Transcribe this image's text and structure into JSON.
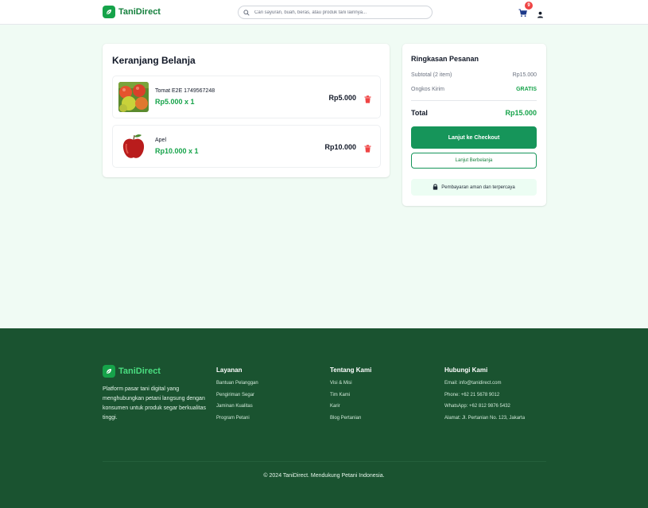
{
  "header": {
    "brand": "TaniDirect",
    "search_placeholder": "Cari sayuran, buah, beras, atau produk tani lainnya...",
    "cart_count": "9"
  },
  "cart": {
    "title": "Keranjang Belanja",
    "items": [
      {
        "name": "Tomat E2E 1749567248",
        "price_qty": "Rp5.000 x 1",
        "total": "Rp5.000"
      },
      {
        "name": "Apel",
        "price_qty": "Rp10.000 x 1",
        "total": "Rp10.000"
      }
    ]
  },
  "summary": {
    "title": "Ringkasan Pesanan",
    "subtotal_label": "Subtotal (2 item)",
    "subtotal_value": "Rp15.000",
    "shipping_label": "Ongkos Kirim",
    "shipping_value": "GRATIS",
    "total_label": "Total",
    "total_value": "Rp15.000",
    "checkout_label": "Lanjut ke Checkout",
    "continue_label": "Lanjut Berbelanja",
    "secure_text": "Pembayaran aman dan terpercaya"
  },
  "footer": {
    "brand": "TaniDirect",
    "about": "Platform pasar tani digital yang menghubungkan petani langsung dengan konsumen untuk produk segar berkualitas tinggi.",
    "columns": [
      {
        "title": "Layanan",
        "links": [
          "Bantuan Pelanggan",
          "Pengiriman Segar",
          "Jaminan Kualitas",
          "Program Petani"
        ]
      },
      {
        "title": "Tentang Kami",
        "links": [
          "Visi & Misi",
          "Tim Kami",
          "Karir",
          "Blog Pertanian"
        ]
      },
      {
        "title": "Hubungi Kami",
        "links": [
          "Email: info@tanidirect.com",
          "Phone: +62 21 5678 9012",
          "WhatsApp: +62 812 9876 5432",
          "Alamat: Jl. Pertanian No. 123, Jakarta"
        ]
      }
    ],
    "copyright": "© 2024 TaniDirect. Mendukung Petani Indonesia."
  },
  "colors": {
    "brand_green": "#16a34a",
    "footer_bg": "#1a5330",
    "badge_red": "#ef4444"
  },
  "icons": [
    "leaf-icon",
    "search-icon",
    "cart-icon",
    "user-icon",
    "trash-icon",
    "lock-icon"
  ]
}
